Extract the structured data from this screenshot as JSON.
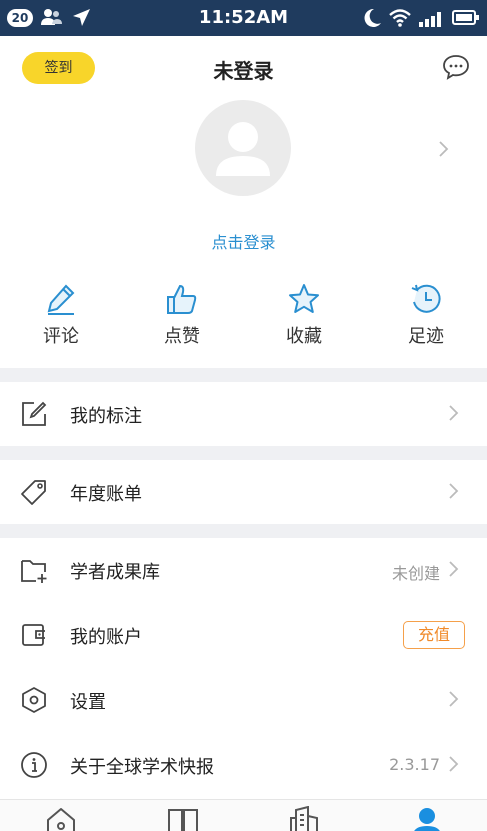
{
  "status_bar": {
    "notification_count": "20",
    "time": "11:52AM",
    "icons": [
      "contacts-icon",
      "location-arrow-icon",
      "moon-icon",
      "wifi-icon",
      "signal-icon",
      "battery-icon"
    ]
  },
  "header": {
    "sign_in_label": "签到",
    "title": "未登录",
    "message_icon": "chat-bubble-icon"
  },
  "profile": {
    "login_link": "点击登录"
  },
  "quick_actions": [
    {
      "label": "评论",
      "icon": "pencil-icon"
    },
    {
      "label": "点赞",
      "icon": "thumbs-up-icon"
    },
    {
      "label": "收藏",
      "icon": "star-icon"
    },
    {
      "label": "足迹",
      "icon": "history-clock-icon"
    }
  ],
  "menu": {
    "my_notes": {
      "label": "我的标注",
      "icon": "edit-square-icon"
    },
    "annual_bill": {
      "label": "年度账单",
      "icon": "tag-icon"
    },
    "scholar_library": {
      "label": "学者成果库",
      "value": "未创建",
      "icon": "folder-plus-icon"
    },
    "my_account": {
      "label": "我的账户",
      "badge": "充值",
      "icon": "wallet-icon"
    },
    "settings": {
      "label": "设置",
      "icon": "hexagon-settings-icon"
    },
    "about": {
      "label": "关于全球学术快报",
      "value": "2.3.17",
      "icon": "info-icon"
    }
  },
  "bottom_nav": {
    "items": [
      "home-icon",
      "book-icon",
      "buildings-icon",
      "user-icon"
    ],
    "active_color": "#1a8fe0"
  },
  "colors": {
    "status_bar_bg": "#1f3b5e",
    "accent_blue": "#2a8fd0",
    "sign_button_bg": "#f8d52a",
    "recharge_orange": "#f08a2a"
  }
}
